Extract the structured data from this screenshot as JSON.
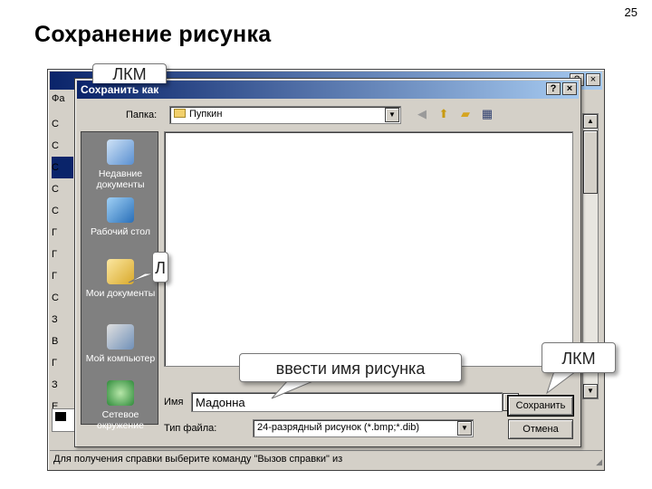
{
  "slide": {
    "number": "25",
    "title": "Сохранение рисунка"
  },
  "background_window": {
    "menu_first_letter": "Фа",
    "sys_buttons": [
      "?",
      "×"
    ],
    "tool_letters": [
      "С",
      "С",
      "С",
      "С",
      "С",
      "Г",
      "Г",
      "Г",
      "С",
      "З",
      "В",
      "Г",
      "З",
      "Е"
    ],
    "status_text": "Для получения справки выберите команду \"Вызов справки\" из"
  },
  "dialog": {
    "title": "Сохранить как",
    "title_buttons": [
      "?",
      "×"
    ],
    "folder_label": "Папка:",
    "folder_value": "Пупкин",
    "places": [
      {
        "label": "Недавние документы",
        "icon": "recent-documents-icon"
      },
      {
        "label": "Рабочий стол",
        "icon": "desktop-icon"
      },
      {
        "label": "Мои документы",
        "icon": "my-documents-icon"
      },
      {
        "label": "Мой компьютер",
        "icon": "my-computer-icon"
      },
      {
        "label": "Сетевое окружение",
        "icon": "network-places-icon"
      }
    ],
    "name_label": "Имя",
    "name_value": "Мадонна",
    "type_label": "Тип файла:",
    "type_value": "24-разрядный рисунок (*.bmp;*.dib)",
    "save_button": "Сохранить",
    "cancel_button": "Отмена"
  },
  "callouts": {
    "top": "ЛКМ",
    "left": "Л",
    "name": "ввести имя рисунка",
    "save": "ЛКМ"
  },
  "colors": {
    "titlebar_start": "#0a246a",
    "titlebar_end": "#a6caf0",
    "places_bg": "#808080",
    "dialog_bg": "#d4d0c8"
  }
}
